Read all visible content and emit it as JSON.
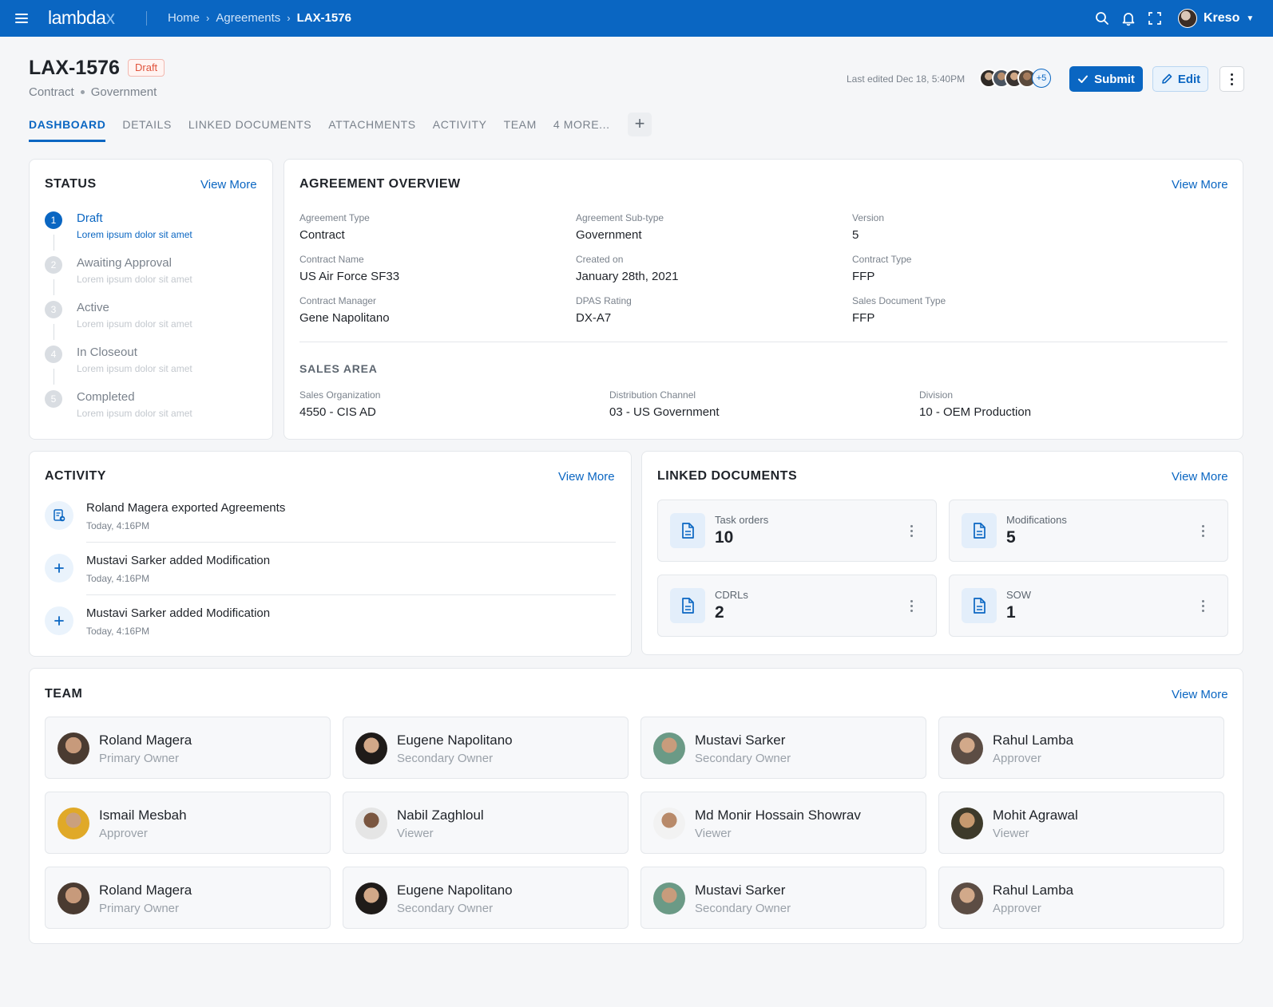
{
  "topbar": {
    "logo_main": "lambda",
    "logo_accent": "x",
    "breadcrumbs": [
      "Home",
      "Agreements",
      "LAX-1576"
    ],
    "user_name": "Kreso"
  },
  "header": {
    "title": "LAX-1576",
    "status_badge": "Draft",
    "meta_type": "Contract",
    "meta_subtype": "Government",
    "last_edited": "Last edited Dec 18, 5:40PM",
    "avatar_overflow": "+5",
    "submit_label": "Submit",
    "edit_label": "Edit"
  },
  "tabs": [
    "DASHBOARD",
    "DETAILS",
    "LINKED DOCUMENTS",
    "ATTACHMENTS",
    "ACTIVITY",
    "TEAM",
    "4 MORE..."
  ],
  "status": {
    "title": "STATUS",
    "view_more": "View More",
    "steps": [
      {
        "num": "1",
        "label": "Draft",
        "desc": "Lorem ipsum dolor sit amet"
      },
      {
        "num": "2",
        "label": "Awaiting Approval",
        "desc": "Lorem ipsum dolor sit amet"
      },
      {
        "num": "3",
        "label": "Active",
        "desc": "Lorem ipsum dolor sit amet"
      },
      {
        "num": "4",
        "label": "In Closeout",
        "desc": "Lorem ipsum dolor sit amet"
      },
      {
        "num": "5",
        "label": "Completed",
        "desc": "Lorem ipsum dolor sit amet"
      }
    ]
  },
  "overview": {
    "title": "AGREEMENT OVERVIEW",
    "view_more": "View More",
    "fields": [
      {
        "label": "Agreement Type",
        "value": "Contract"
      },
      {
        "label": "Agreement Sub-type",
        "value": "Government"
      },
      {
        "label": "Version",
        "value": "5"
      },
      {
        "label": "Contract Name",
        "value": "US Air Force SF33"
      },
      {
        "label": "Created on",
        "value": "January 28th, 2021"
      },
      {
        "label": "Contract Type",
        "value": "FFP"
      },
      {
        "label": "Contract Manager",
        "value": "Gene Napolitano"
      },
      {
        "label": "DPAS Rating",
        "value": "DX-A7"
      },
      {
        "label": "Sales Document Type",
        "value": "FFP"
      }
    ],
    "sales_area_title": "SALES AREA",
    "sales_area": [
      {
        "label": "Sales Organization",
        "value": "4550 - CIS AD"
      },
      {
        "label": "Distribution Channel",
        "value": "03 - US Government"
      },
      {
        "label": "Division",
        "value": "10 - OEM Production"
      }
    ]
  },
  "activity": {
    "title": "ACTIVITY",
    "view_more": "View More",
    "items": [
      {
        "text": "Roland Magera exported Agreements",
        "time": "Today, 4:16PM",
        "icon": "export-document-icon"
      },
      {
        "text": "Mustavi Sarker added Modification",
        "time": "Today, 4:16PM",
        "icon": "plus-icon"
      },
      {
        "text": "Mustavi Sarker added Modification",
        "time": "Today, 4:16PM",
        "icon": "plus-icon"
      }
    ]
  },
  "linked_documents": {
    "title": "LINKED DOCUMENTS",
    "view_more": "View More",
    "items": [
      {
        "label": "Task orders",
        "count": "10"
      },
      {
        "label": "Modifications",
        "count": "5"
      },
      {
        "label": "CDRLs",
        "count": "2"
      },
      {
        "label": "SOW",
        "count": "1"
      }
    ]
  },
  "team": {
    "title": "TEAM",
    "view_more": "View More",
    "members": [
      {
        "name": "Roland Magera",
        "role": "Primary Owner"
      },
      {
        "name": "Eugene Napolitano",
        "role": "Secondary Owner"
      },
      {
        "name": "Mustavi Sarker",
        "role": "Secondary Owner"
      },
      {
        "name": "Rahul Lamba",
        "role": "Approver"
      },
      {
        "name": "Ismail Mesbah",
        "role": "Approver"
      },
      {
        "name": "Nabil Zaghloul",
        "role": "Viewer"
      },
      {
        "name": "Md Monir Hossain Showrav",
        "role": "Viewer"
      },
      {
        "name": "Mohit Agrawal",
        "role": "Viewer"
      },
      {
        "name": "Roland Magera",
        "role": "Primary Owner"
      },
      {
        "name": "Eugene Napolitano",
        "role": "Secondary Owner"
      },
      {
        "name": "Mustavi Sarker",
        "role": "Secondary Owner"
      },
      {
        "name": "Rahul Lamba",
        "role": "Approver"
      }
    ]
  },
  "colors": {
    "primary": "#0a66c2",
    "draft_badge": "#e0533c",
    "page_bg": "#f5f6f8"
  }
}
